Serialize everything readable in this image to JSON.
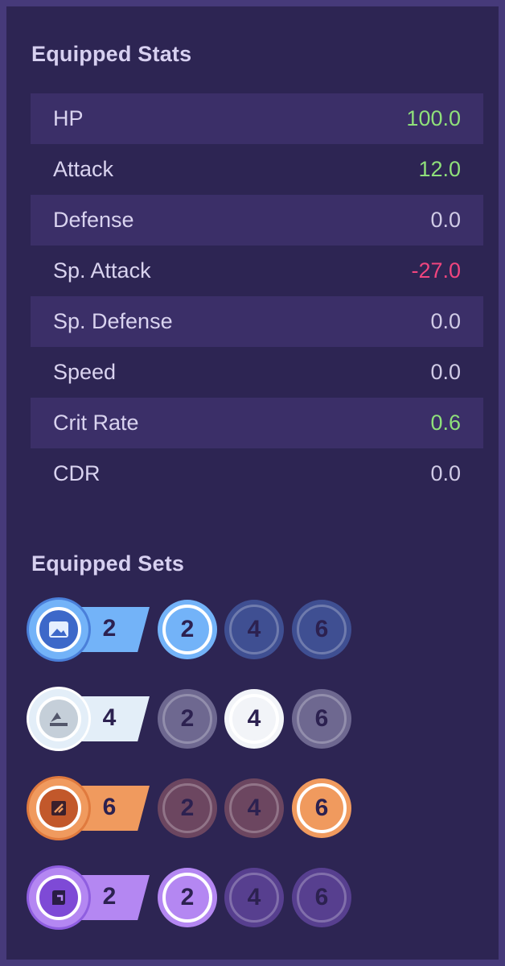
{
  "stats": {
    "title": "Equipped Stats",
    "rows": [
      {
        "label": "HP",
        "value": "100.0",
        "tone": "pos"
      },
      {
        "label": "Attack",
        "value": "12.0",
        "tone": "pos"
      },
      {
        "label": "Defense",
        "value": "0.0",
        "tone": "neutral"
      },
      {
        "label": "Sp. Attack",
        "value": "-27.0",
        "tone": "neg"
      },
      {
        "label": "Sp. Defense",
        "value": "0.0",
        "tone": "neutral"
      },
      {
        "label": "Speed",
        "value": "0.0",
        "tone": "neutral"
      },
      {
        "label": "Crit Rate",
        "value": "0.6",
        "tone": "pos"
      },
      {
        "label": "CDR",
        "value": "0.0",
        "tone": "neutral"
      }
    ]
  },
  "sets": {
    "title": "Equipped Sets",
    "items": [
      {
        "icon": "blue-set-icon",
        "count": "2",
        "accent": "#73b3f8",
        "iconBg": "#3d68c9",
        "tiers": [
          "2",
          "4",
          "6"
        ],
        "activeTier": 0,
        "dimBg": "#3f4f92"
      },
      {
        "icon": "white-set-icon",
        "count": "4",
        "accent": "#e3eef8",
        "iconBg": "#c5cfd9",
        "tiers": [
          "2",
          "4",
          "6"
        ],
        "activeTier": 1,
        "dimBg": "#6e6890"
      },
      {
        "icon": "orange-set-icon",
        "count": "6",
        "accent": "#f09a5e",
        "iconBg": "#c2582b",
        "tiers": [
          "2",
          "4",
          "6"
        ],
        "activeTier": 2,
        "dimBg": "#6c4660"
      },
      {
        "icon": "purple-set-icon",
        "count": "2",
        "accent": "#b487f2",
        "iconBg": "#7e4ad6",
        "tiers": [
          "2",
          "4",
          "6"
        ],
        "activeTier": 0,
        "dimBg": "#573f8f"
      }
    ]
  }
}
